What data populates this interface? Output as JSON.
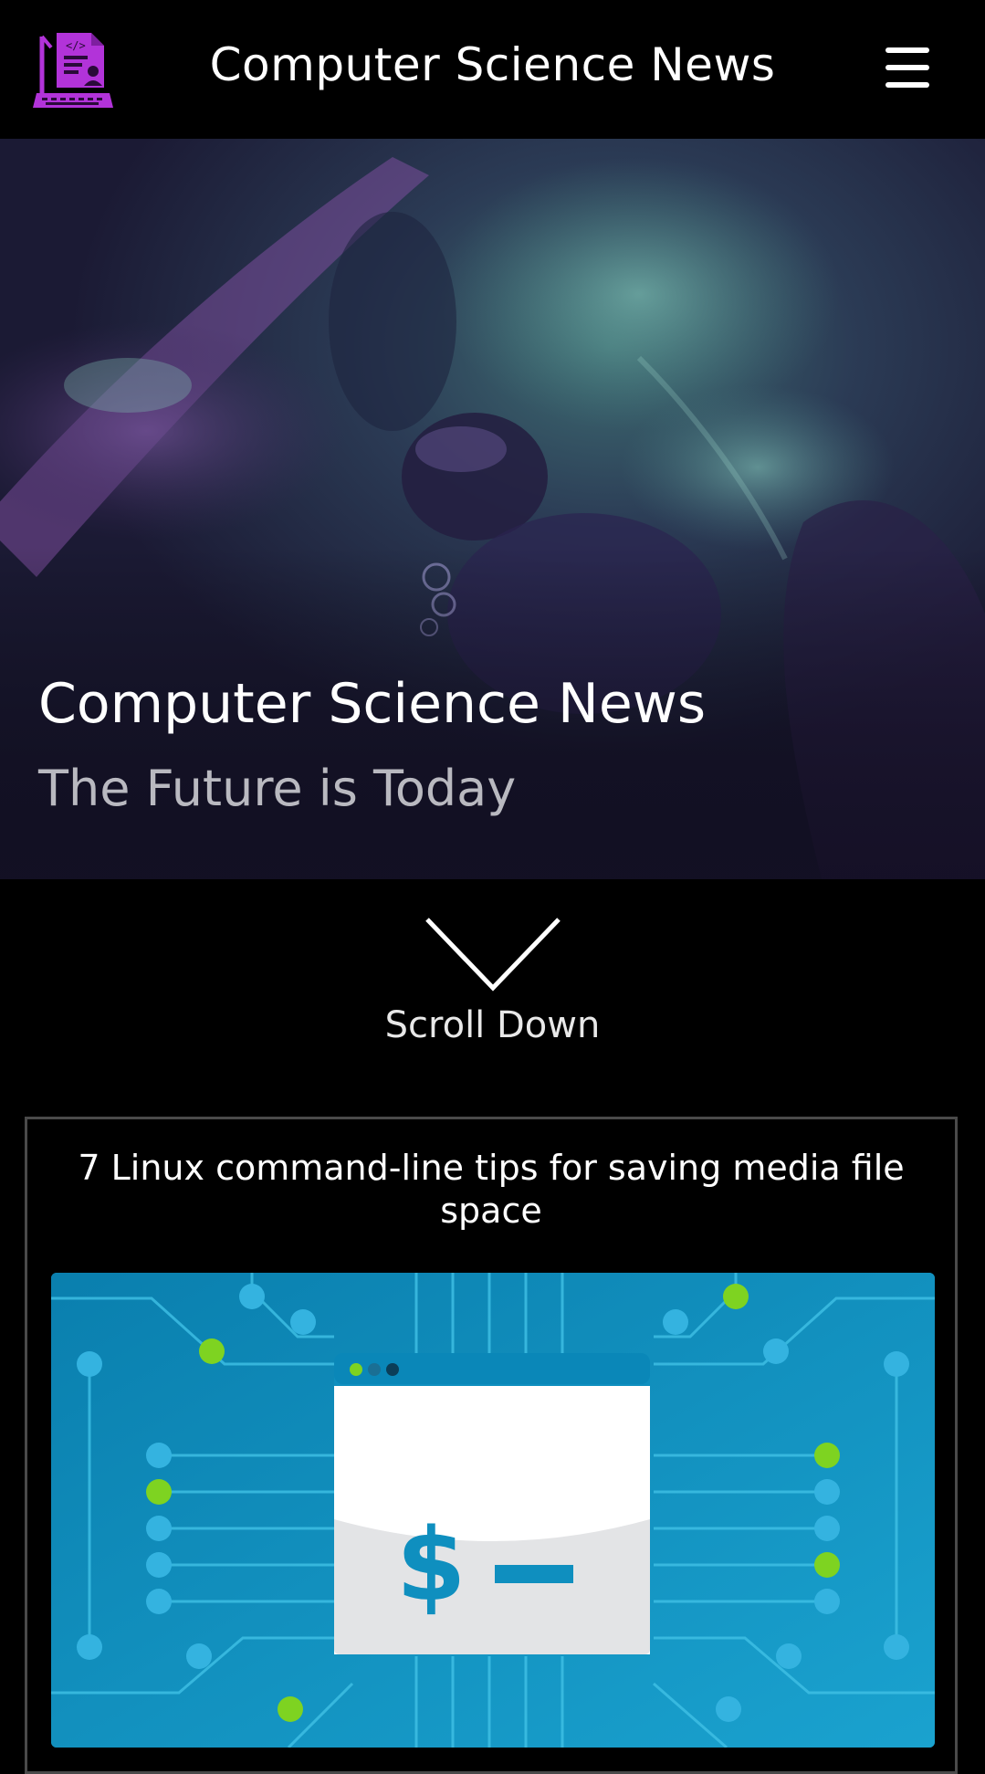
{
  "header": {
    "site_title": "Computer Science News",
    "logo_icon": "computer-code-logo-icon",
    "menu_icon": "hamburger-menu-icon"
  },
  "hero": {
    "title": "Computer Science News",
    "subtitle": "The Future is Today"
  },
  "scroll": {
    "label": "Scroll Down",
    "icon": "chevron-down-icon"
  },
  "articles": [
    {
      "title": "7 Linux command-line tips for saving media file space",
      "image_icon": "terminal-dollar-prompt-illustration"
    }
  ],
  "colors": {
    "background": "#000000",
    "logo_accent": "#b233d9",
    "hero_tint": "#24203f",
    "card_border": "#4a4a4a",
    "article_image_blue": "#0e86b5",
    "circuit_green": "#7ed321"
  }
}
